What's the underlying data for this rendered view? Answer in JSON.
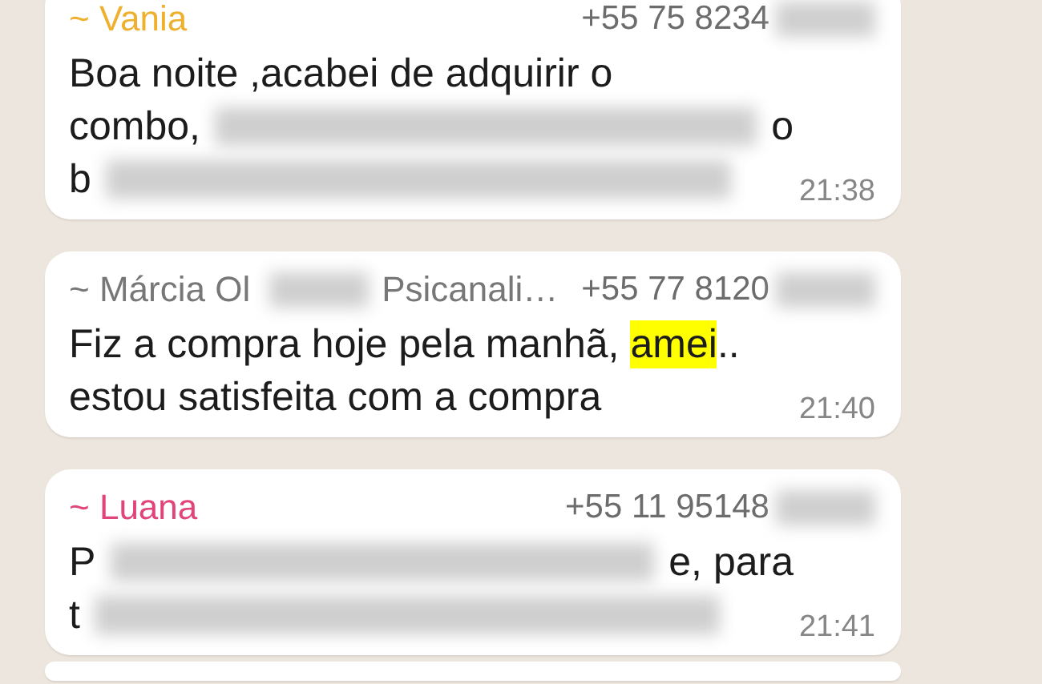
{
  "messages": [
    {
      "kind": "full",
      "sender": [
        {
          "kind": "text",
          "text": "~ Vania"
        }
      ],
      "color": "#eeb02f",
      "phone": "+55 75 8234",
      "phone_blurred": true,
      "lines": [
        [
          {
            "kind": "text",
            "text": "Boa noite ,acabei de adquirir o"
          }
        ],
        [
          {
            "kind": "text",
            "text": "combo,"
          },
          {
            "kind": "blur"
          },
          {
            "kind": "text",
            "text": "o"
          }
        ],
        [
          {
            "kind": "text",
            "text": "b"
          },
          {
            "kind": "blur"
          }
        ]
      ],
      "time": "21:38"
    },
    {
      "kind": "full",
      "sender": [
        {
          "kind": "text",
          "text": "~ Márcia Ol"
        },
        {
          "kind": "blur"
        },
        {
          "kind": "text",
          "text": "Psicanali…"
        }
      ],
      "color": "#777777",
      "phone": "+55 77 8120",
      "phone_blurred": true,
      "lines": [
        [
          {
            "kind": "text",
            "text": "Fiz a compra hoje pela manhã,"
          },
          {
            "kind": "highlight",
            "text": "amei"
          },
          {
            "kind": "text",
            "text": ".."
          }
        ],
        [
          {
            "kind": "text",
            "text": "estou satisfeita com a compra"
          }
        ]
      ],
      "time": "21:40"
    },
    {
      "kind": "full",
      "sender": [
        {
          "kind": "text",
          "text": "~ Luana"
        }
      ],
      "color": "#e0447a",
      "phone": "+55 11 95148",
      "phone_blurred": true,
      "lines": [
        [
          {
            "kind": "text",
            "text": "P"
          },
          {
            "kind": "blur"
          },
          {
            "kind": "text",
            "text": "e, para"
          }
        ],
        [
          {
            "kind": "text",
            "text": "t"
          },
          {
            "kind": "blur"
          }
        ]
      ],
      "time": "21:41"
    },
    {
      "kind": "cut"
    }
  ]
}
